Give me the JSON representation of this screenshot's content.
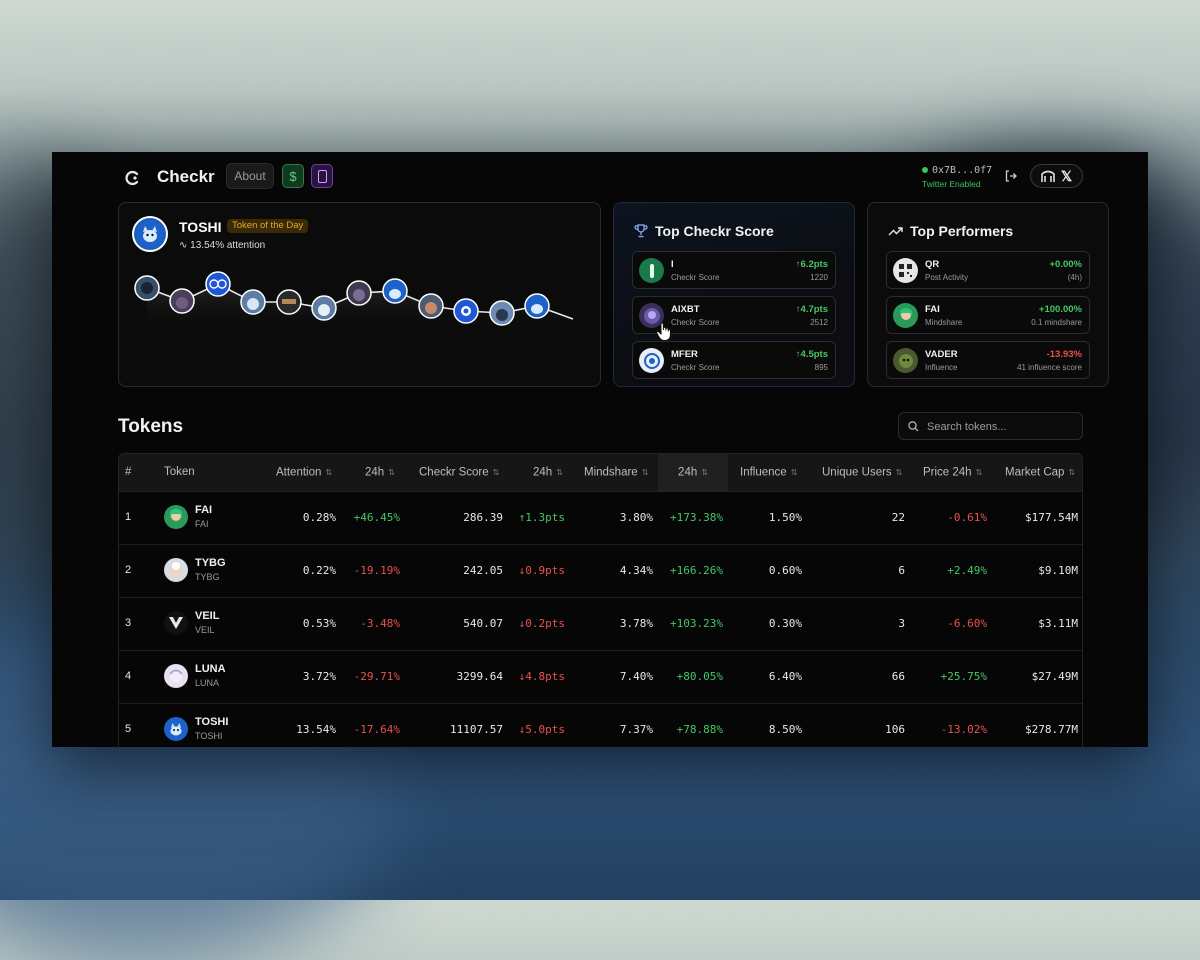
{
  "app": {
    "name": "Checkr",
    "about_label": "About",
    "dollar_label": "$"
  },
  "wallet": {
    "address": "0x7B...0f7",
    "status": "Twitter Enabled"
  },
  "token_of_day": {
    "name": "TOSHI",
    "badge": "Token of the Day",
    "attention": "13.54% attention"
  },
  "top_score": {
    "title": "Top Checkr Score",
    "items": [
      {
        "name": "I",
        "label": "Checkr Score",
        "change": "↑6.2pts",
        "value": "1220"
      },
      {
        "name": "AIXBT",
        "label": "Checkr Score",
        "change": "↑4.7pts",
        "value": "2512"
      },
      {
        "name": "MFER",
        "label": "Checkr Score",
        "change": "↑4.5pts",
        "value": "895"
      }
    ]
  },
  "top_performers": {
    "title": "Top Performers",
    "items": [
      {
        "name": "QR",
        "label": "Post Activity",
        "change": "+0.00%",
        "sub": "(4h)",
        "trend": "pos"
      },
      {
        "name": "FAI",
        "label": "Mindshare",
        "change": "+100.00%",
        "sub": "0.1 mindshare",
        "trend": "pos"
      },
      {
        "name": "VADER",
        "label": "Influence",
        "change": "-13.93%",
        "sub": "41 influence score",
        "trend": "neg"
      }
    ]
  },
  "tokens": {
    "title": "Tokens",
    "search_placeholder": "Search tokens...",
    "columns": [
      "#",
      "Token",
      "Attention",
      "24h",
      "Checkr Score",
      "24h",
      "Mindshare",
      "24h",
      "Influence",
      "Unique Users",
      "Price 24h",
      "Market Cap"
    ],
    "rows": [
      {
        "rank": "1",
        "name": "FAI",
        "symbol": "FAI",
        "attention": "0.28%",
        "attention_24h": "+46.45%",
        "score": "286.39",
        "score_24h": "↑1.3pts",
        "mindshare": "3.80%",
        "mindshare_24h": "+173.38%",
        "influence": "1.50%",
        "users": "22",
        "price_24h": "-0.61%",
        "market_cap": "$177.54M",
        "a_trend": "pos",
        "s_trend": "pos",
        "m_trend": "pos",
        "p_trend": "neg"
      },
      {
        "rank": "2",
        "name": "TYBG",
        "symbol": "TYBG",
        "attention": "0.22%",
        "attention_24h": "-19.19%",
        "score": "242.05",
        "score_24h": "↓0.9pts",
        "mindshare": "4.34%",
        "mindshare_24h": "+166.26%",
        "influence": "0.60%",
        "users": "6",
        "price_24h": "+2.49%",
        "market_cap": "$9.10M",
        "a_trend": "neg",
        "s_trend": "neg",
        "m_trend": "pos",
        "p_trend": "pos"
      },
      {
        "rank": "3",
        "name": "VEIL",
        "symbol": "VEIL",
        "attention": "0.53%",
        "attention_24h": "-3.48%",
        "score": "540.07",
        "score_24h": "↓0.2pts",
        "mindshare": "3.78%",
        "mindshare_24h": "+103.23%",
        "influence": "0.30%",
        "users": "3",
        "price_24h": "-6.60%",
        "market_cap": "$3.11M",
        "a_trend": "neg",
        "s_trend": "neg",
        "m_trend": "pos",
        "p_trend": "neg"
      },
      {
        "rank": "4",
        "name": "LUNA",
        "symbol": "LUNA",
        "attention": "3.72%",
        "attention_24h": "-29.71%",
        "score": "3299.64",
        "score_24h": "↓4.8pts",
        "mindshare": "7.40%",
        "mindshare_24h": "+80.05%",
        "influence": "6.40%",
        "users": "66",
        "price_24h": "+25.75%",
        "market_cap": "$27.49M",
        "a_trend": "neg",
        "s_trend": "neg",
        "m_trend": "pos",
        "p_trend": "pos"
      },
      {
        "rank": "5",
        "name": "TOSHI",
        "symbol": "TOSHI",
        "attention": "13.54%",
        "attention_24h": "-17.64%",
        "score": "11107.57",
        "score_24h": "↓5.0pts",
        "mindshare": "7.37%",
        "mindshare_24h": "+78.88%",
        "influence": "8.50%",
        "users": "106",
        "price_24h": "-13.02%",
        "market_cap": "$278.77M",
        "a_trend": "neg",
        "s_trend": "neg",
        "m_trend": "pos",
        "p_trend": "neg"
      }
    ]
  },
  "colors": {
    "positive": "#45c766",
    "negative": "#e85151",
    "badge": "#e3a72b",
    "accent_green": "#3ac55e"
  }
}
